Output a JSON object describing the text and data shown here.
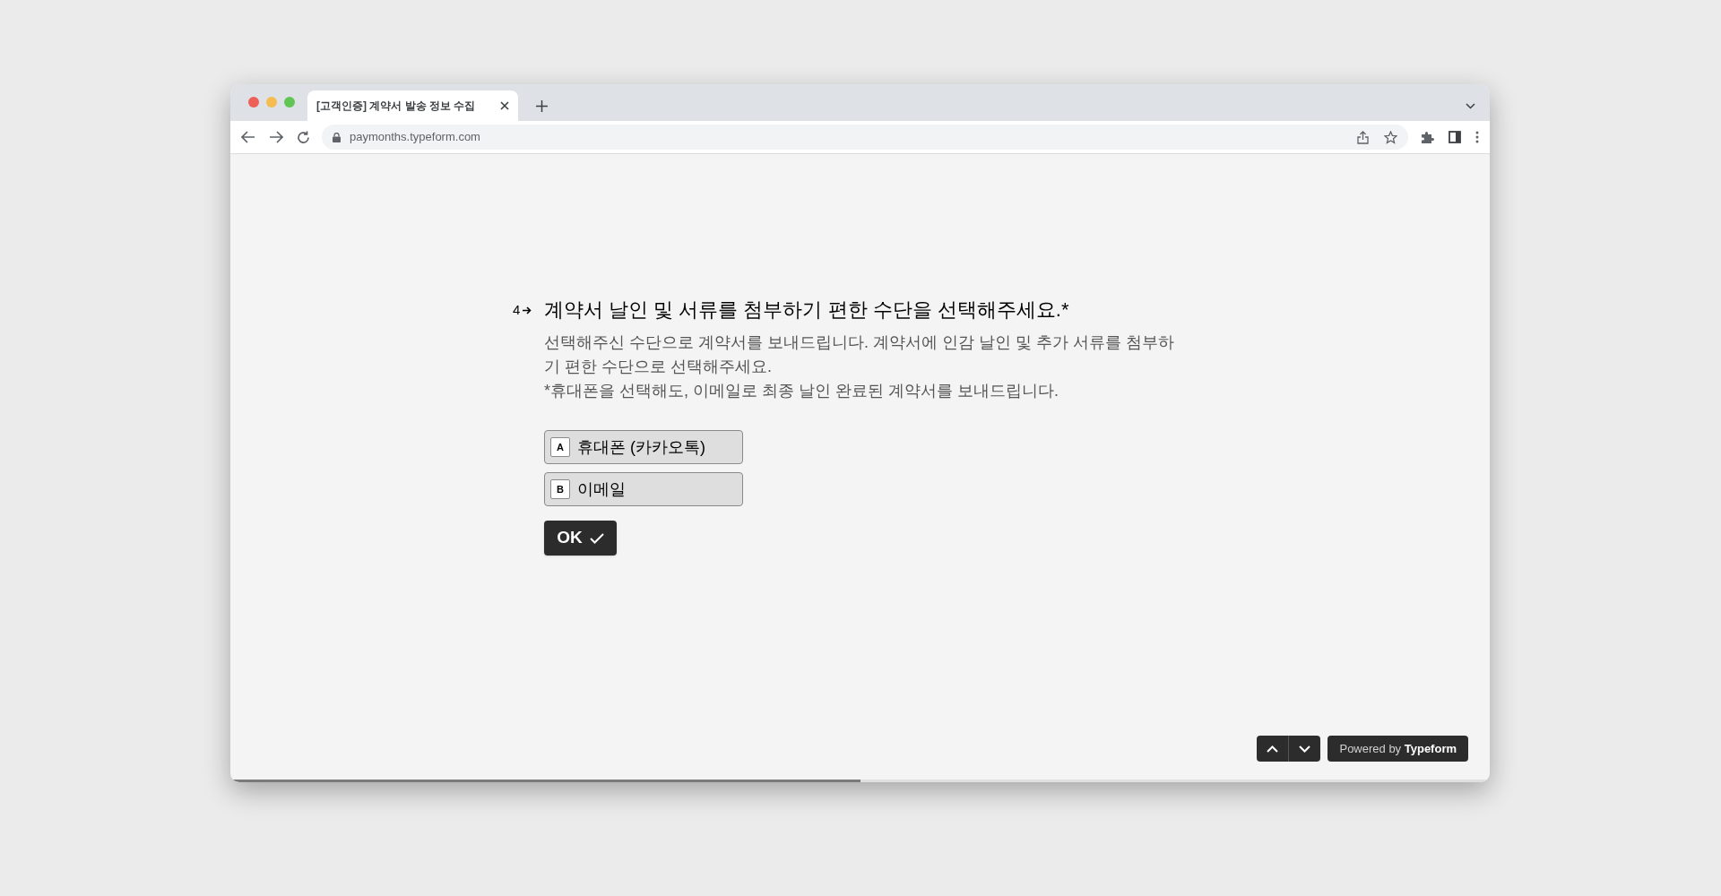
{
  "browser": {
    "tab": {
      "title": "[고객인증] 계약서 발송 정보 수집"
    },
    "url": "paymonths.typeform.com"
  },
  "question": {
    "number": "4",
    "title": "계약서 날인 및 서류를 첨부하기 편한 수단을 선택해주세요.*",
    "description": [
      "선택해주신 수단으로 계약서를 보내드립니다. 계약서에 인감 날인 및 추가 서류를 첨부하기 편한 수단으로 선택해주세요.",
      "*휴대폰을 선택해도, 이메일로 최종 날인 완료된 계약서를 보내드립니다."
    ],
    "choices": [
      {
        "key": "A",
        "label": "휴대폰 (카카오톡)"
      },
      {
        "key": "B",
        "label": "이메일"
      }
    ],
    "ok_button": "OK"
  },
  "footer": {
    "powered_by": "Powered by **Typeform**"
  },
  "progress": {
    "level": 0.5
  }
}
